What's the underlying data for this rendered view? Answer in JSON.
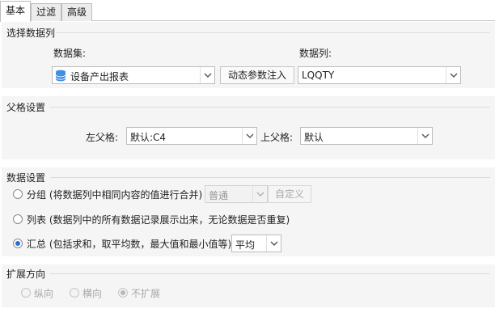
{
  "tabs": [
    {
      "label": "基本"
    },
    {
      "label": "过滤"
    },
    {
      "label": "高级"
    }
  ],
  "select_column": {
    "title": "选择数据列",
    "dataset_label": "数据集:",
    "column_label": "数据列:",
    "dataset_value": "设备产出报表",
    "dynamic_button": "动态参数注入",
    "column_value": "LQQTY"
  },
  "parent_settings": {
    "title": "父格设置",
    "left_label": "左父格:",
    "left_value": "默认:C4",
    "top_label": "上父格:",
    "top_value": "默认"
  },
  "data_settings": {
    "title": "数据设置",
    "group_label": "分组 (将数据列中相同内容的值进行合并)",
    "group_mode_value": "普通",
    "custom_button": "自定义",
    "list_label": "列表 (数据列中的所有数据记录展示出来，无论数据是否重复)",
    "summary_label": "汇总 (包括求和，取平均数，最大值和最小值等)",
    "summary_value": "平均",
    "selected": "summary"
  },
  "expand": {
    "title": "扩展方向",
    "vertical": "纵向",
    "horizontal": "横向",
    "none": "不扩展",
    "selected": "none"
  },
  "colors": {
    "accent": "#2a6fd6",
    "db_icon": "#3a8ee6"
  }
}
